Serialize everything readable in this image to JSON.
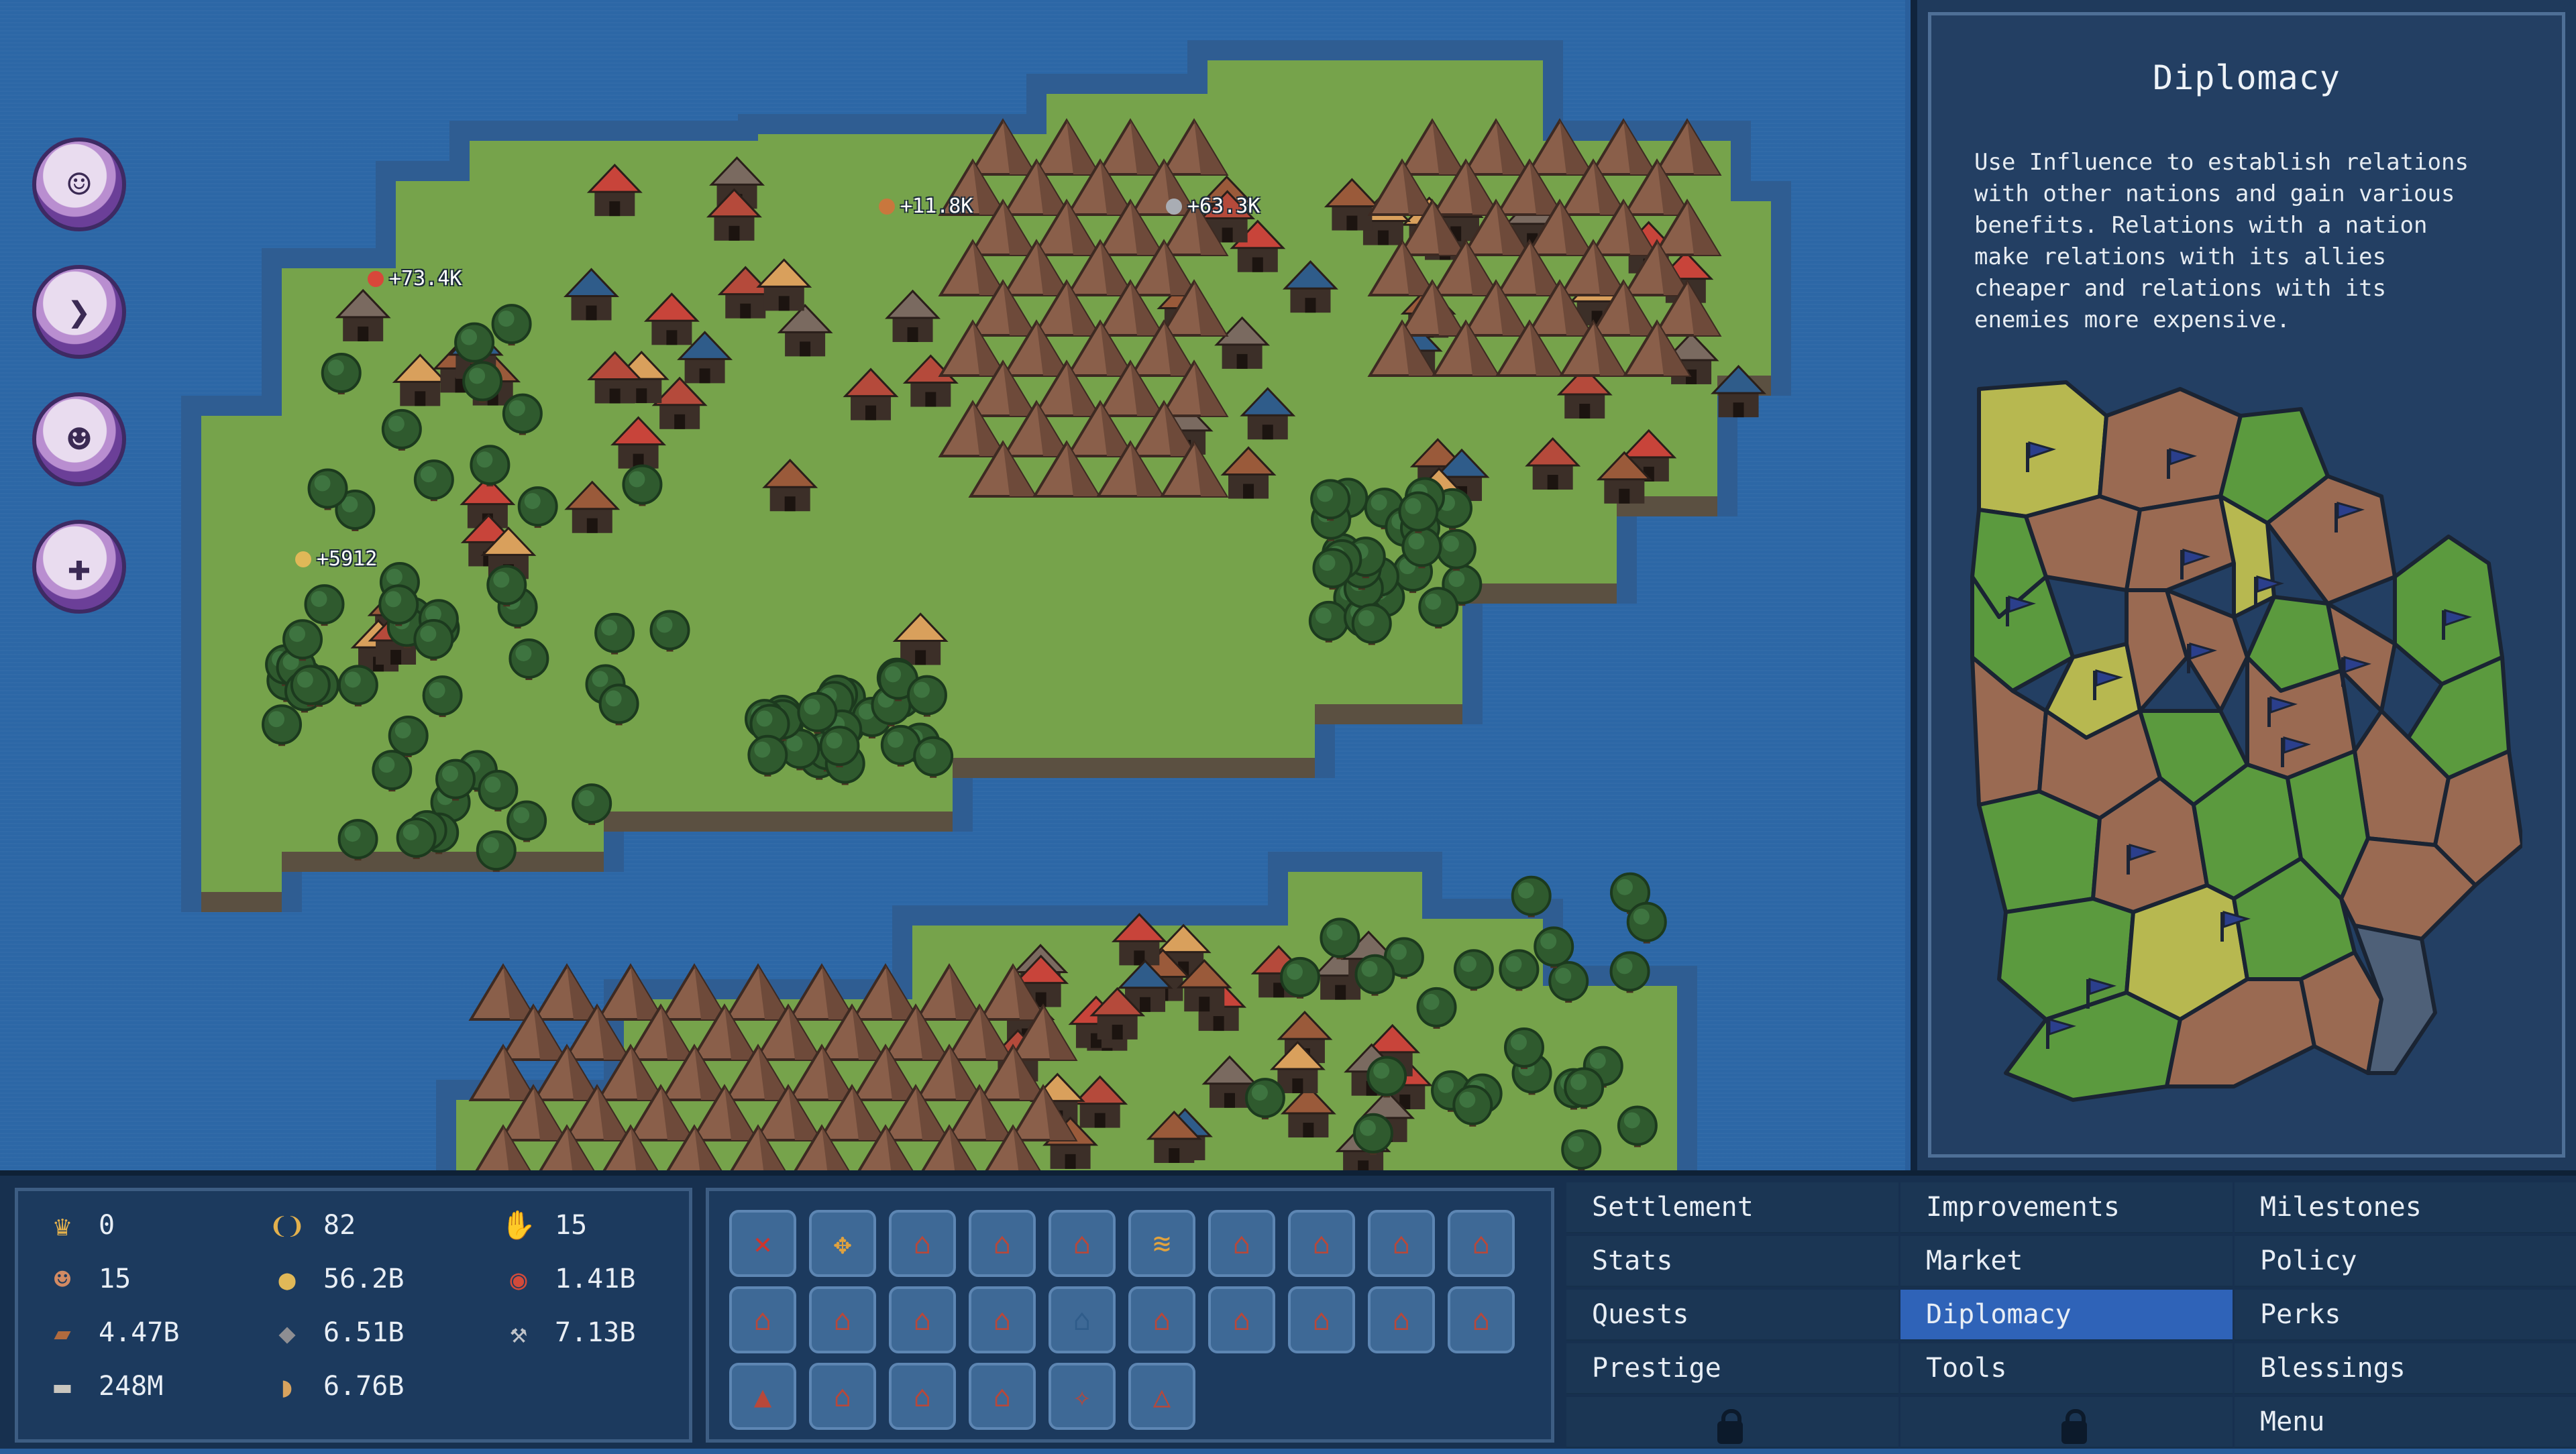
{
  "floating_labels": [
    {
      "text": "+73.4K",
      "color": "#d8473a",
      "icon": "meat-icon"
    },
    {
      "text": "+11.8K",
      "color": "#c9773d",
      "icon": "wood-icon"
    },
    {
      "text": "+63.3K",
      "color": "#a9adb4",
      "icon": "tools-icon"
    },
    {
      "text": "+5912",
      "color": "#e0b858",
      "icon": "coin-icon"
    }
  ],
  "side_buttons": [
    {
      "name": "advisor-1-button",
      "icon": "advisor-icon",
      "glyph": "☺"
    },
    {
      "name": "advisor-2-button",
      "icon": "merchant-icon",
      "glyph": "❯"
    },
    {
      "name": "advisor-3-button",
      "icon": "scholar-icon",
      "glyph": "☻"
    },
    {
      "name": "advisor-4-button",
      "icon": "priest-icon",
      "glyph": "✚"
    }
  ],
  "diplomacy": {
    "title": "Diplomacy",
    "description": "Use Influence to establish relations\nwith other nations and gain various\nbenefits. Relations with a nation\nmake relations with its allies\ncheaper and relations with its\nenemies more expensive."
  },
  "colors": {
    "region_yellow": "#b7b850",
    "region_green": "#5b9a3e",
    "region_brown": "#9a6a52",
    "region_grey": "#4e6078",
    "grass": "#76a34b",
    "shore": "#2f5d92",
    "accent": "#2f63b8"
  },
  "resources": [
    {
      "icon": "crown-icon",
      "glyph": "♛",
      "color": "#e2b04d",
      "value": "0"
    },
    {
      "icon": "population-icon",
      "glyph": "☻",
      "color": "#d28a63",
      "value": "15"
    },
    {
      "icon": "wood-icon",
      "glyph": "▰",
      "color": "#b06a3e",
      "value": "4.47B"
    },
    {
      "icon": "plank-icon",
      "glyph": "▬",
      "color": "#c9c6bf",
      "value": "248M"
    },
    {
      "icon": "laurel-icon",
      "glyph": "❨❩",
      "color": "#e2b04d",
      "value": "82"
    },
    {
      "icon": "coin-icon",
      "glyph": "●",
      "color": "#e0b858",
      "value": "56.2B"
    },
    {
      "icon": "stone-icon",
      "glyph": "◆",
      "color": "#8e8e92",
      "value": "6.51B"
    },
    {
      "icon": "bread-icon",
      "glyph": "◗",
      "color": "#d8a35e",
      "value": "6.76B"
    },
    {
      "icon": "faith-icon",
      "glyph": "✋",
      "color": "#d8a0a0",
      "value": "15"
    },
    {
      "icon": "meat-icon",
      "glyph": "◉",
      "color": "#d24a3a",
      "value": "1.41B"
    },
    {
      "icon": "tools-icon",
      "glyph": "⚒",
      "color": "#c0c4ca",
      "value": "7.13B"
    }
  ],
  "build_tools": [
    [
      "demolish-icon",
      "move-icon",
      "hut-icon",
      "house-icon",
      "manor-icon",
      "wheat-field-icon",
      "lumber-mill-icon",
      "smithy-icon",
      "quarry-icon",
      "map-icon"
    ],
    [
      "tent-icon",
      "mine-icon",
      "forge-icon",
      "bakery-icon",
      "well-icon",
      "warehouse-icon",
      "barn-icon",
      "workshop-icon",
      "storehouse-icon",
      "market-icon"
    ],
    [
      "lighthouse-icon",
      "cave-icon",
      "shrine-icon",
      "temple-icon",
      "statue-icon",
      "monument-icon"
    ]
  ],
  "menu": [
    {
      "label": "Settlement",
      "col": 0,
      "row": 0
    },
    {
      "label": "Stats",
      "col": 0,
      "row": 1
    },
    {
      "label": "Quests",
      "col": 0,
      "row": 2
    },
    {
      "label": "Prestige",
      "col": 0,
      "row": 3
    },
    {
      "label": "Improvements",
      "col": 1,
      "row": 0
    },
    {
      "label": "Market",
      "col": 1,
      "row": 1
    },
    {
      "label": "Diplomacy",
      "col": 1,
      "row": 2,
      "active": true
    },
    {
      "label": "Tools",
      "col": 1,
      "row": 3
    },
    {
      "label": "Milestones",
      "col": 2,
      "row": 0
    },
    {
      "label": "Policy",
      "col": 2,
      "row": 1
    },
    {
      "label": "Perks",
      "col": 2,
      "row": 2
    },
    {
      "label": "Blessings",
      "col": 2,
      "row": 3
    },
    {
      "label": "Menu",
      "col": 2,
      "row": 4
    }
  ]
}
